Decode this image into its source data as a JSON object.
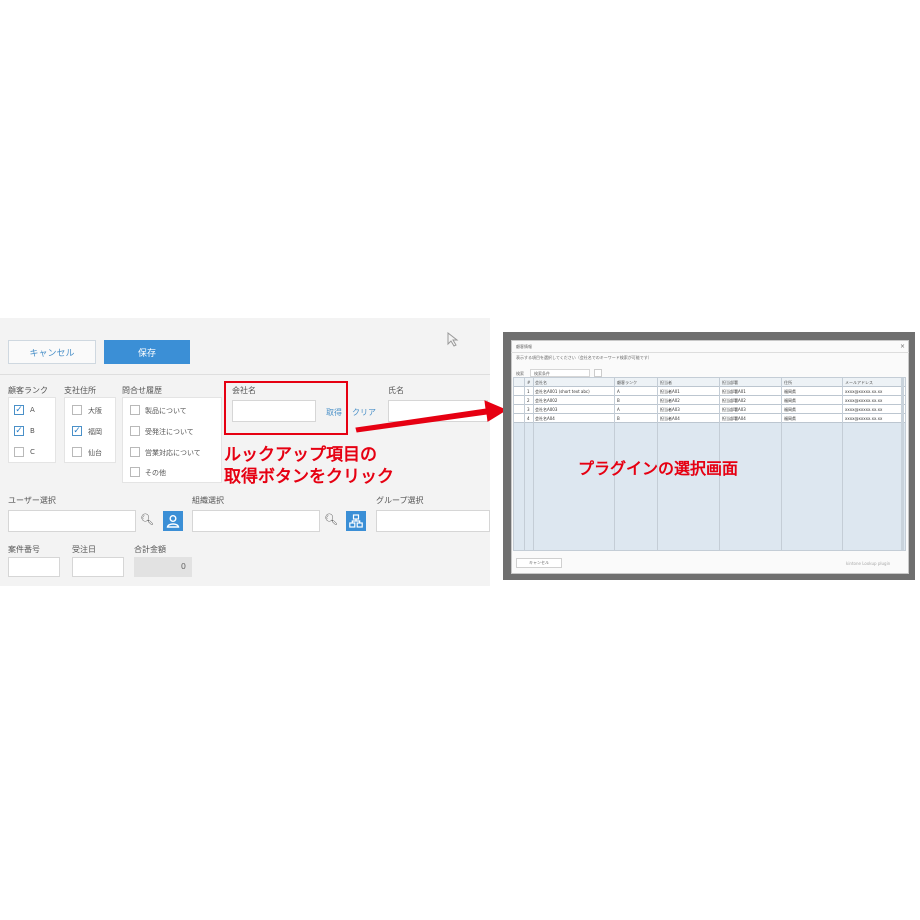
{
  "form": {
    "cancel_label": "キャンセル",
    "save_label": "保存",
    "customer_rank": {
      "label": "顧客ランク",
      "options": [
        {
          "label": "A",
          "checked": true
        },
        {
          "label": "B",
          "checked": true
        },
        {
          "label": "C",
          "checked": false
        }
      ]
    },
    "branch": {
      "label": "支社住所",
      "options": [
        {
          "label": "大阪",
          "checked": false
        },
        {
          "label": "福岡",
          "checked": true
        },
        {
          "label": "仙台",
          "checked": false
        }
      ]
    },
    "inquiry": {
      "label": "問合せ履歴",
      "options": [
        {
          "label": "製品について",
          "checked": false
        },
        {
          "label": "受発注について",
          "checked": false
        },
        {
          "label": "営業対応について",
          "checked": false
        },
        {
          "label": "その他",
          "checked": false
        }
      ]
    },
    "company": {
      "label": "会社名",
      "value": "",
      "fetch_label": "取得",
      "clear_label": "クリア"
    },
    "name_label": "氏名",
    "user_select_label": "ユーザー選択",
    "org_select_label": "組織選択",
    "group_select_label": "グループ選択",
    "case_no_label": "案件番号",
    "due_label": "受注日",
    "total_label": "合計金額",
    "total_value": "0"
  },
  "annotations": {
    "lookup_line1": "ルックアップ項目の",
    "lookup_line2": "取得ボタンをクリック",
    "plugin_caption": "プラグインの選択画面"
  },
  "dialog": {
    "title": "顧客情報",
    "close": "×",
    "note": "表示する項目を選択してください（会社名でのキーワード検索が可能です）",
    "search_label": "検索",
    "search_value": "検索条件",
    "columns": [
      "#",
      "会社名",
      "顧客ランク",
      "担当者",
      "担当部署",
      "住所",
      "メールアドレス"
    ],
    "rows": [
      [
        "1",
        "会社名A001 (short text abc)",
        "A",
        "担当者A01",
        "担当部署A01",
        "福岡県",
        "xxxx@xxxxx.xx.xx"
      ],
      [
        "2",
        "会社名A002",
        "B",
        "担当者A02",
        "担当部署A02",
        "福岡県",
        "xxxx@xxxxx.xx.xx"
      ],
      [
        "3",
        "会社名A003",
        "A",
        "担当者A03",
        "担当部署A03",
        "福岡県",
        "xxxx@xxxxx.xx.xx"
      ],
      [
        "4",
        "会社名A04",
        "B",
        "担当者A04",
        "担当部署A04",
        "福岡県",
        "xxxx@xxxxx.xx.xx"
      ]
    ],
    "cancel_label": "キャンセル",
    "footer_note": "kintone Lookup plugin"
  },
  "colors": {
    "accent": "#3b8fd6",
    "annotation": "#e60012"
  }
}
